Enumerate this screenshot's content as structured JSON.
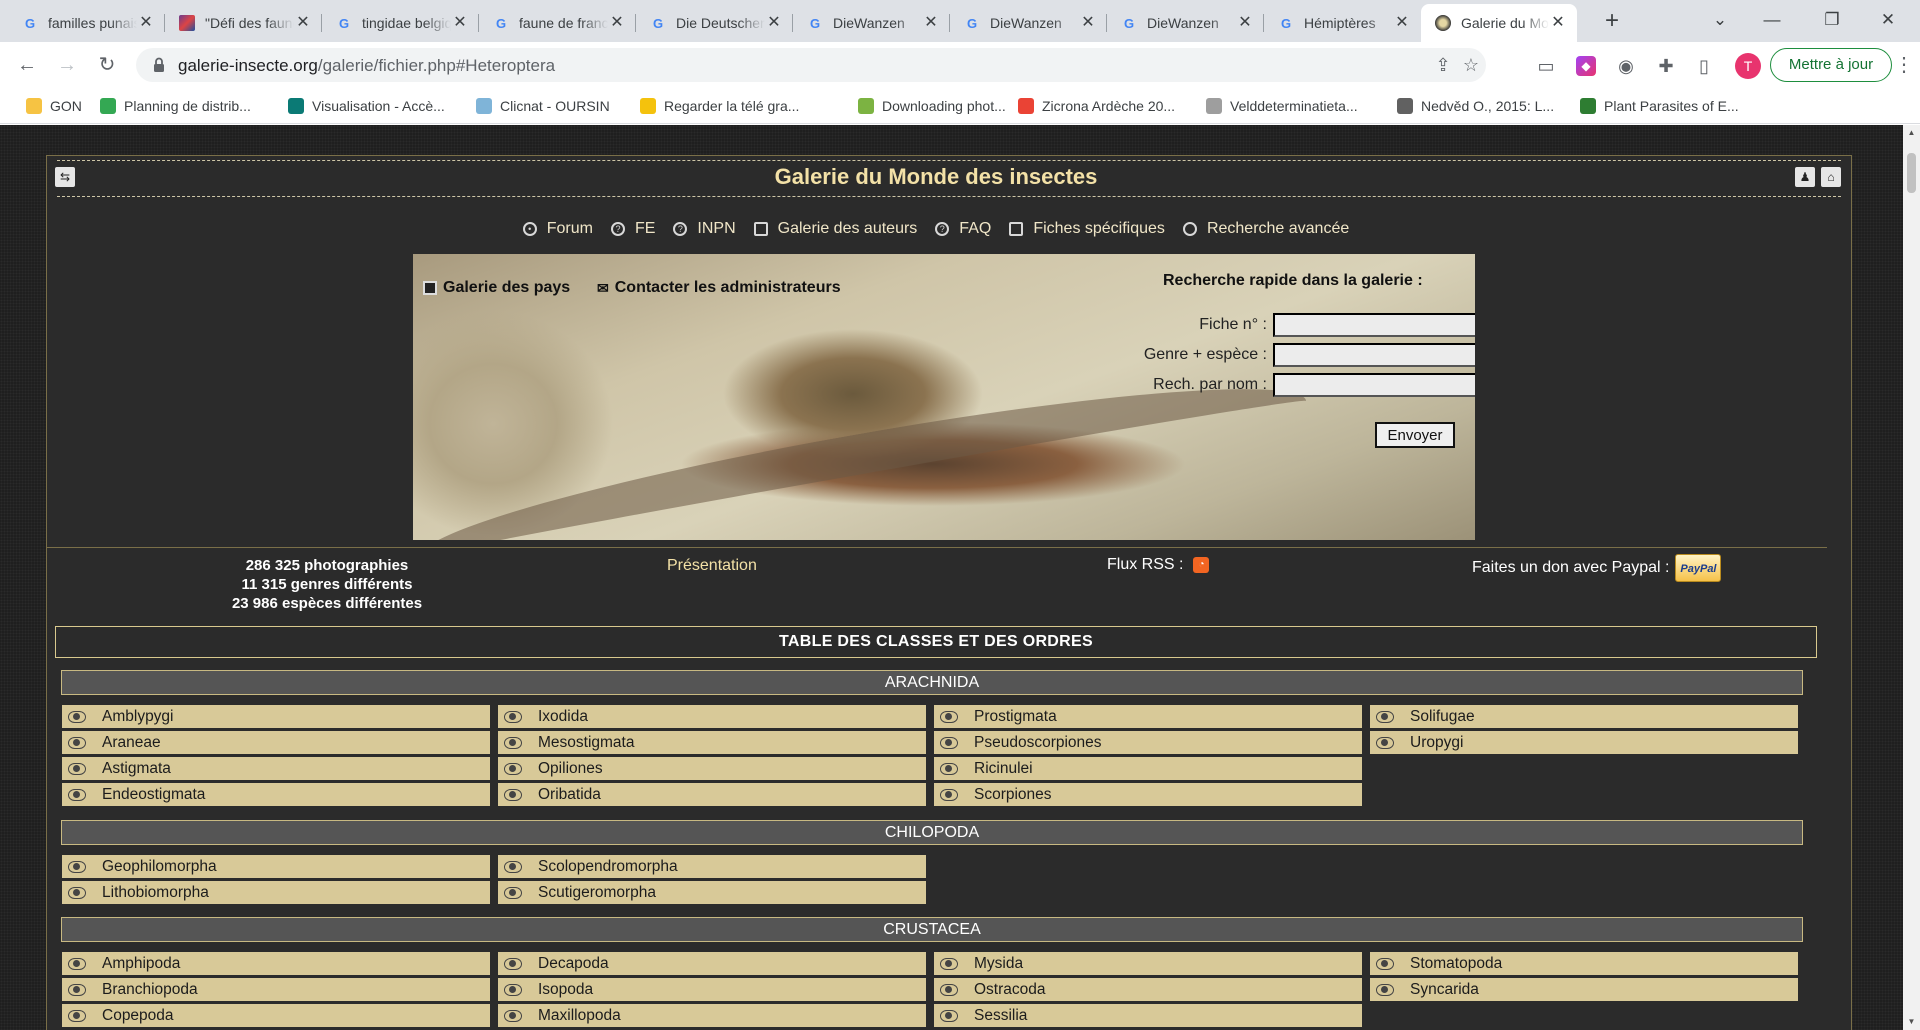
{
  "browser": {
    "tabs": [
      {
        "title": "familles punaises",
        "icon": "google-icon"
      },
      {
        "title": "\"Défi des faunes\"",
        "icon": "image-icon"
      },
      {
        "title": "tingidae belgique",
        "icon": "google-icon"
      },
      {
        "title": "faune de france",
        "icon": "google-icon"
      },
      {
        "title": "Die Deutschen",
        "icon": "google-icon"
      },
      {
        "title": "DieWanzen",
        "icon": "google-icon"
      },
      {
        "title": "DieWanzen",
        "icon": "google-icon"
      },
      {
        "title": "DieWanzen",
        "icon": "google-icon"
      },
      {
        "title": "Hémiptères",
        "icon": "google-icon"
      },
      {
        "title": "Galerie du Monde",
        "icon": "gallery-icon",
        "active": true
      }
    ],
    "url_host": "galerie-insecte.org",
    "url_path": "/galerie/fichier.php#Heteroptera",
    "avatar_letter": "T",
    "update_label": "Mettre à jour",
    "bookmarks": [
      {
        "label": "GON",
        "color": "#f6c343"
      },
      {
        "label": "Planning de distrib...",
        "color": "#34a853"
      },
      {
        "label": "Visualisation - Accè...",
        "color": "#0b7a75"
      },
      {
        "label": "Clicnat - OURSIN",
        "color": "#7fb4d8"
      },
      {
        "label": "Regarder la télé gra...",
        "color": "#f4c20d"
      },
      {
        "label": "Downloading phot...",
        "color": "#7cb342"
      },
      {
        "label": "Zicrona Ardèche 20...",
        "color": "#ea4335"
      },
      {
        "label": "Velddeterminatieta...",
        "color": "#9e9e9e"
      },
      {
        "label": "Nedvěd O., 2015: L...",
        "color": "#616161"
      },
      {
        "label": "Plant Parasites of E...",
        "color": "#2e7d32"
      }
    ]
  },
  "site": {
    "title": "Galerie du Monde des insectes",
    "nav": [
      {
        "label": "Forum",
        "icon": "users-icon"
      },
      {
        "label": "FE",
        "icon": "help-icon"
      },
      {
        "label": "INPN",
        "icon": "help-icon"
      },
      {
        "label": "Galerie des auteurs",
        "icon": "document-icon"
      },
      {
        "label": "FAQ",
        "icon": "help-icon"
      },
      {
        "label": "Fiches spécifiques",
        "icon": "document-icon"
      },
      {
        "label": "Recherche avancée",
        "icon": "search-icon"
      }
    ],
    "banner_links": {
      "countries": "Galerie des pays",
      "contact": "Contacter les administrateurs"
    },
    "quick_search": {
      "title": "Recherche rapide dans la galerie :",
      "fields": [
        "Fiche n° :",
        "Genre + espèce :",
        "Rech. par nom :"
      ],
      "submit": "Envoyer"
    },
    "stats": [
      "286 325 photographies",
      "11 315 genres différents",
      "23 986 espèces différentes"
    ],
    "presentation": "Présentation",
    "rss_label": "Flux RSS :",
    "paypal_label": "Faites un don avec Paypal :",
    "paypal_badge": "PayPal",
    "table_title": "TABLE DES CLASSES ET DES ORDRES",
    "classes": [
      {
        "name": "ARACHNIDA",
        "columns": [
          [
            "Amblypygi",
            "Araneae",
            "Astigmata",
            "Endeostigmata"
          ],
          [
            "Ixodida",
            "Mesostigmata",
            "Opiliones",
            "Oribatida"
          ],
          [
            "Prostigmata",
            "Pseudoscorpiones",
            "Ricinulei",
            "Scorpiones"
          ],
          [
            "Solifugae",
            "Uropygi"
          ]
        ]
      },
      {
        "name": "CHILOPODA",
        "columns": [
          [
            "Geophilomorpha",
            "Lithobiomorpha"
          ],
          [
            "Scolopendromorpha",
            "Scutigeromorpha"
          ]
        ]
      },
      {
        "name": "CRUSTACEA",
        "columns": [
          [
            "Amphipoda",
            "Branchiopoda",
            "Copepoda"
          ],
          [
            "Decapoda",
            "Isopoda",
            "Maxillopoda"
          ],
          [
            "Mysida",
            "Ostracoda",
            "Sessilia"
          ],
          [
            "Stomatopoda",
            "Syncarida"
          ]
        ]
      }
    ]
  }
}
